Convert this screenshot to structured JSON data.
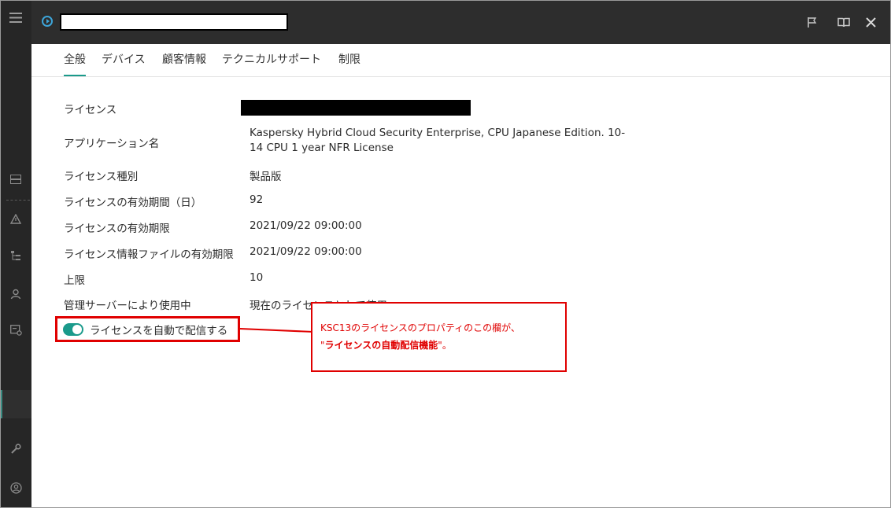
{
  "rail": {
    "icons": [
      "menu-icon",
      "server-icon",
      "warning-icon",
      "hierarchy-icon",
      "user-icon",
      "license-icon",
      "wrench-icon",
      "account-icon"
    ],
    "menu_glyph": "≡"
  },
  "header": {
    "close_glyph": "✕",
    "flag_glyph": "⚑",
    "book_glyph": "🕮"
  },
  "tabs": [
    {
      "label": "全般"
    },
    {
      "label": "デバイス"
    },
    {
      "label": "顧客情報"
    },
    {
      "label": "テクニカルサポート"
    },
    {
      "label": "制限"
    }
  ],
  "properties": {
    "license_label": "ライセンス",
    "app_name_label": "アプリケーション名",
    "app_name_value": "Kaspersky Hybrid Cloud Security Enterprise, CPU Japanese Edition. 10-14 CPU 1 year NFR License",
    "license_type_label": "ライセンス種別",
    "license_type_value": "製品版",
    "validity_days_label": "ライセンスの有効期間（日）",
    "validity_days_value": "92",
    "expiry_label": "ライセンスの有効期限",
    "expiry_value": "2021/09/22 09:00:00",
    "keyfile_expiry_label": "ライセンス情報ファイルの有効期限",
    "keyfile_expiry_value": "2021/09/22 09:00:00",
    "limit_label": "上限",
    "limit_value": "10",
    "used_by_label": "管理サーバーにより使用中",
    "used_by_value": "現在のライセンスとして使用"
  },
  "toggle": {
    "label": "ライセンスを自動で配信する",
    "on": true
  },
  "annotation": {
    "line1": "KSC13のライセンスのプロパティのこの欄が、",
    "line2_quote_open": "\"",
    "line2_bold": "ライセンスの自動配信機能",
    "line2_rest": "\"。"
  },
  "colors": {
    "accent": "#1a9a8b",
    "annotation": "#e00000",
    "header_bg": "#2d2d2d",
    "rail_bg": "#262626"
  }
}
